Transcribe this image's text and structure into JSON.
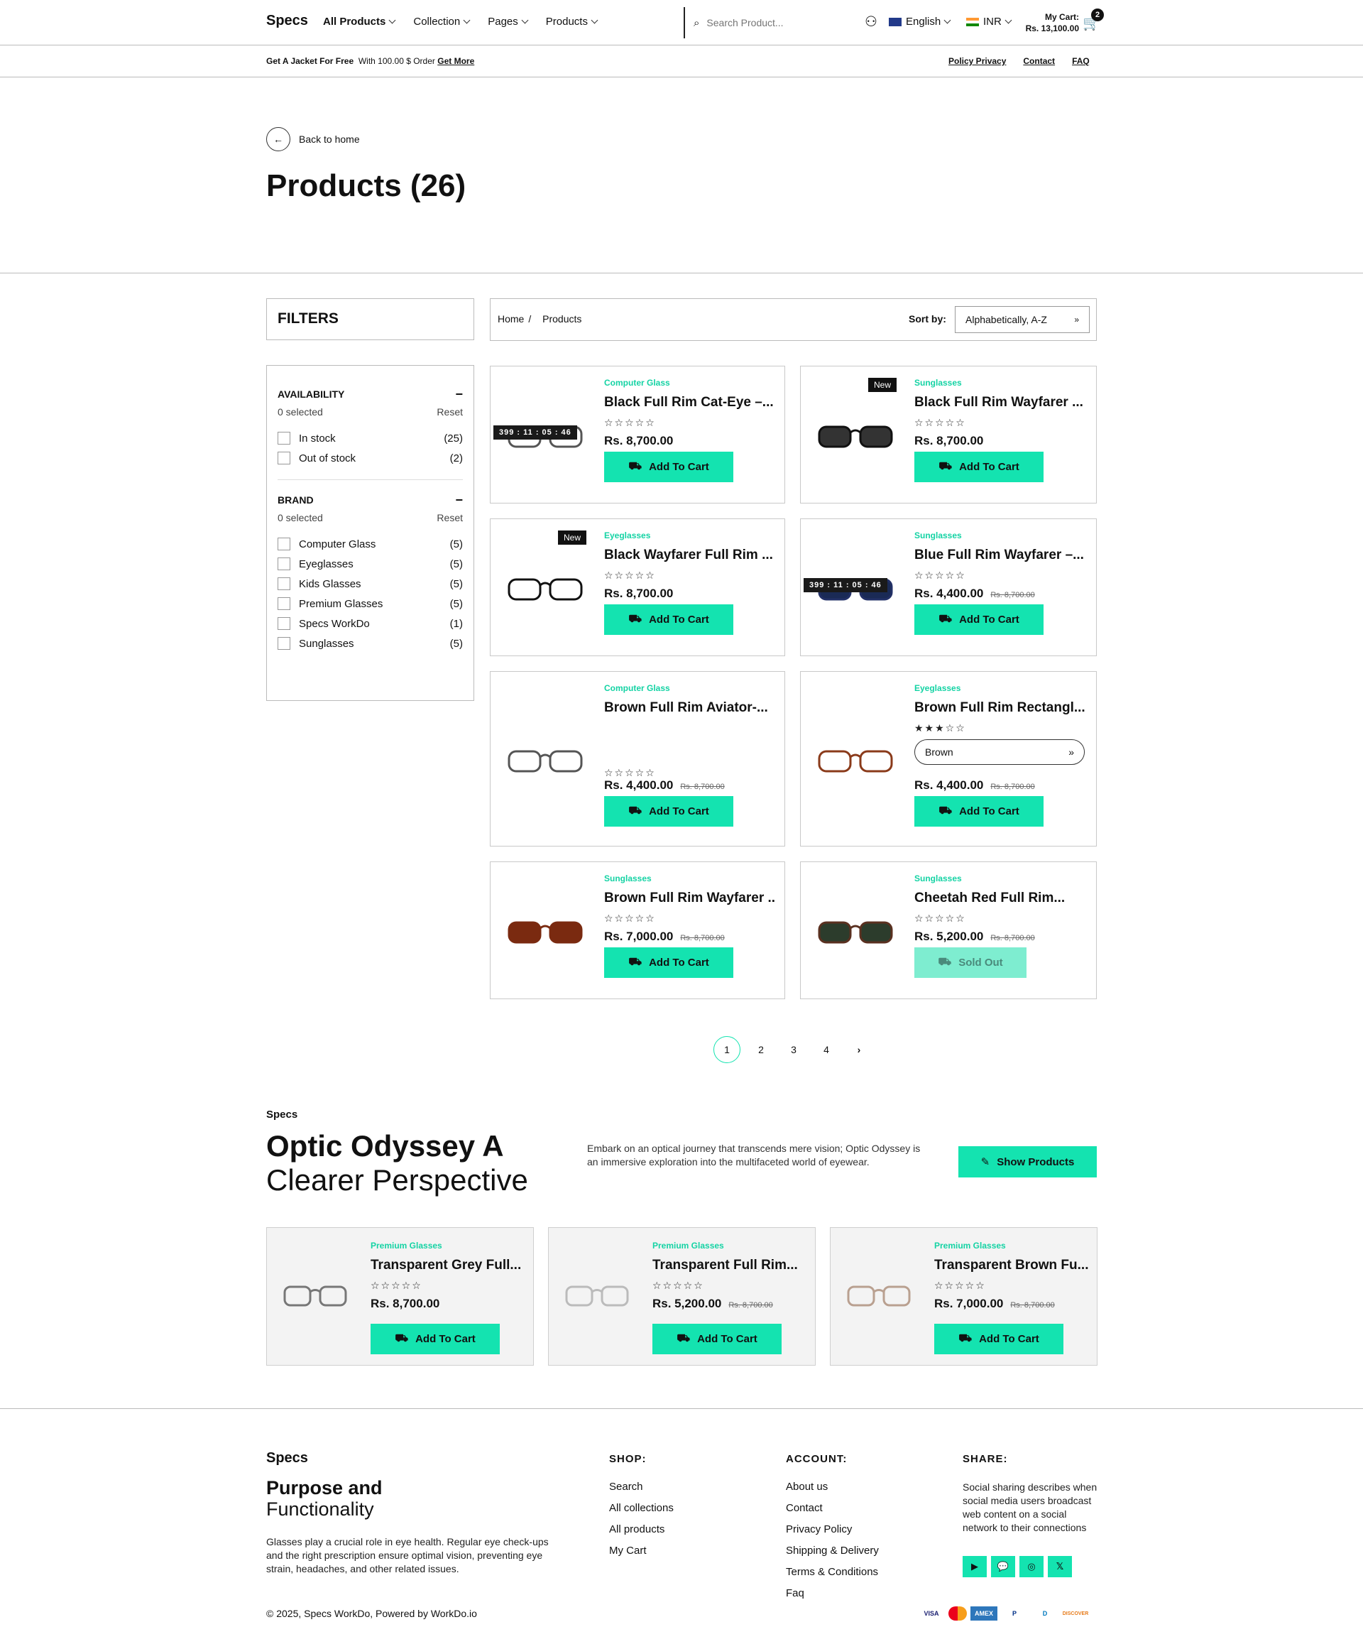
{
  "header": {
    "brand": "Specs",
    "nav": [
      "All Products",
      "Collection",
      "Pages",
      "Products"
    ],
    "search_placeholder": "Search Product...",
    "language": "English",
    "currency": "INR",
    "cart_label": "My Cart:",
    "cart_total": "Rs. 13,100.00",
    "cart_count": "2"
  },
  "promo": {
    "lead": "Get A Jacket For Free",
    "text": "With 100.00 $ Order",
    "link": "Get More",
    "links": [
      "Policy Privacy",
      "Contact",
      "FAQ"
    ]
  },
  "page": {
    "back": "Back to home",
    "title": "Products (26)"
  },
  "filters": {
    "heading": "FILTERS",
    "availability": {
      "title": "AVAILABILITY",
      "selected": "0 selected",
      "reset": "Reset",
      "items": [
        {
          "label": "In stock",
          "count": "(25)"
        },
        {
          "label": "Out of stock",
          "count": "(2)"
        }
      ]
    },
    "brand": {
      "title": "BRAND",
      "selected": "0 selected",
      "reset": "Reset",
      "items": [
        {
          "label": "Computer Glass",
          "count": "(5)"
        },
        {
          "label": "Eyeglasses",
          "count": "(5)"
        },
        {
          "label": "Kids Glasses",
          "count": "(5)"
        },
        {
          "label": "Premium Glasses",
          "count": "(5)"
        },
        {
          "label": "Specs WorkDo",
          "count": "(1)"
        },
        {
          "label": "Sunglasses",
          "count": "(5)"
        }
      ]
    }
  },
  "toolbar": {
    "crumb_home": "Home",
    "crumb_sep": "/",
    "crumb_current": "Products",
    "sort_label": "Sort by:",
    "sort_value": "Alphabetically, A-Z"
  },
  "products": [
    {
      "cat": "Computer Glass",
      "title": "Black Full Rim Cat-Eye –...",
      "stars": "☆☆☆☆☆",
      "price": "Rs. 8,700.00",
      "old": "",
      "btn": "Add To Cart",
      "timer": "399 : 11 : 05 : 46",
      "badge": ""
    },
    {
      "cat": "Sunglasses",
      "title": "Black Full Rim Wayfarer ...",
      "stars": "☆☆☆☆☆",
      "price": "Rs. 8,700.00",
      "old": "",
      "btn": "Add To Cart",
      "timer": "",
      "badge": "New"
    },
    {
      "cat": "Eyeglasses",
      "title": "Black Wayfarer Full Rim ...",
      "stars": "☆☆☆☆☆",
      "price": "Rs. 8,700.00",
      "old": "",
      "btn": "Add To Cart",
      "timer": "",
      "badge": "New"
    },
    {
      "cat": "Sunglasses",
      "title": "Blue Full Rim Wayfarer –...",
      "stars": "☆☆☆☆☆",
      "price": "Rs. 4,400.00",
      "old": "Rs. 8,700.00",
      "btn": "Add To Cart",
      "timer": "399 : 11 : 05 : 46",
      "badge": ""
    },
    {
      "cat": "Computer Glass",
      "title": "Brown Full Rim Aviator-...",
      "stars": "☆☆☆☆☆",
      "price": "Rs. 4,400.00",
      "old": "Rs. 8,700.00",
      "btn": "Add To Cart",
      "timer": "",
      "badge": ""
    },
    {
      "cat": "Eyeglasses",
      "title": "Brown Full Rim Rectangl...",
      "stars": "★★★☆☆",
      "price": "Rs. 4,400.00",
      "old": "Rs. 8,700.00",
      "btn": "Add To Cart",
      "timer": "",
      "badge": "",
      "variant": "Brown"
    },
    {
      "cat": "Sunglasses",
      "title": "Brown Full Rim Wayfarer ...",
      "stars": "☆☆☆☆☆",
      "price": "Rs. 7,000.00",
      "old": "Rs. 8,700.00",
      "btn": "Add To Cart",
      "timer": "",
      "badge": ""
    },
    {
      "cat": "Sunglasses",
      "title": "Cheetah Red Full Rim...",
      "stars": "☆☆☆☆☆",
      "price": "Rs. 5,200.00",
      "old": "Rs. 8,700.00",
      "btn": "Sold Out",
      "timer": "",
      "badge": ""
    }
  ],
  "pagination": [
    "1",
    "2",
    "3",
    "4"
  ],
  "promo_section": {
    "label": "Specs",
    "title_bold": "Optic Odyssey A",
    "title_light": "Clearer Perspective",
    "text": "Embark on an optical journey that transcends mere vision; Optic Odyssey is an immersive exploration into the multifaceted world of eyewear.",
    "button": "Show Products"
  },
  "featured": [
    {
      "cat": "Premium Glasses",
      "title": "Transparent Grey Full...",
      "stars": "☆☆☆☆☆",
      "price": "Rs. 8,700.00",
      "old": "",
      "btn": "Add To Cart"
    },
    {
      "cat": "Premium Glasses",
      "title": "Transparent Full Rim...",
      "stars": "☆☆☆☆☆",
      "price": "Rs. 5,200.00",
      "old": "Rs. 8,700.00",
      "btn": "Add To Cart"
    },
    {
      "cat": "Premium Glasses",
      "title": "Transparent Brown Fu...",
      "stars": "☆☆☆☆☆",
      "price": "Rs. 7,000.00",
      "old": "Rs. 8,700.00",
      "btn": "Add To Cart"
    }
  ],
  "footer": {
    "brand": "Specs",
    "title_bold": "Purpose and",
    "title_light": "Functionality",
    "text": "Glasses play a crucial role in eye health. Regular eye check-ups and the right prescription ensure optimal vision, preventing eye strain, headaches, and other related issues.",
    "shop_title": "SHOP:",
    "shop": [
      "Search",
      "All collections",
      "All products",
      "My Cart"
    ],
    "account_title": "ACCOUNT:",
    "account": [
      "About us",
      "Contact",
      "Privacy Policy",
      "Shipping & Delivery",
      "Terms & Conditions",
      "Faq"
    ],
    "share_title": "SHARE:",
    "share_text": "Social sharing describes when social media users broadcast web content on a social network to their connections",
    "social": [
      "youtube-icon",
      "chat-icon",
      "instagram-icon",
      "x-icon"
    ],
    "copyright": "© 2025, Specs WorkDo, Powered by WorkDo.io",
    "payments": [
      "VISA",
      "MC",
      "AMEX",
      "P",
      "D",
      "DISCOVER"
    ]
  },
  "colors": {
    "accent": "#14e3b0"
  }
}
